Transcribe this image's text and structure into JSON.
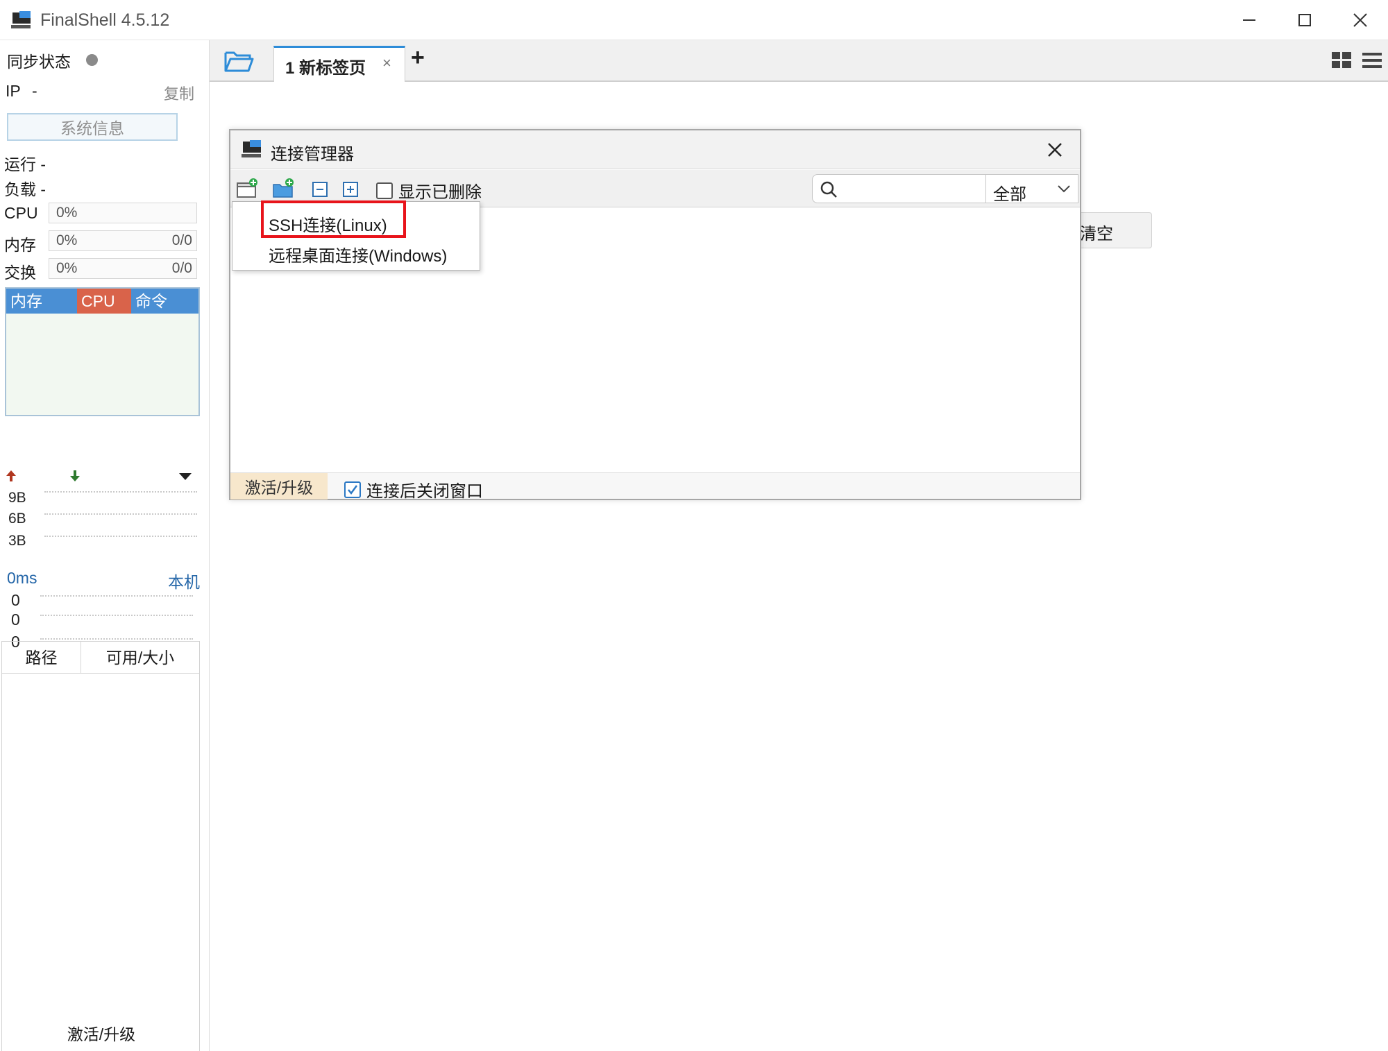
{
  "window": {
    "title": "FinalShell 4.5.12",
    "controls": [
      "minimize-icon",
      "maximize-icon",
      "close-icon"
    ]
  },
  "sidebar": {
    "sync_label": "同步状态",
    "ip_label": "IP",
    "ip_value": "-",
    "copy_label": "复制",
    "sysinfo_label": "系统信息",
    "run_label": "运行 -",
    "load_label": "负载 -",
    "meters": [
      {
        "label": "CPU",
        "percent": "0%",
        "ratio": ""
      },
      {
        "label": "内存",
        "percent": "0%",
        "ratio": "0/0"
      },
      {
        "label": "交换",
        "percent": "0%",
        "ratio": "0/0"
      }
    ],
    "process_tabs": [
      "内存",
      "CPU",
      "命令"
    ],
    "net_labels": [
      "9B",
      "6B",
      "3B"
    ],
    "ping_label": "0ms",
    "ping_host": "本机",
    "ping_values": [
      "0",
      "0",
      "0"
    ],
    "disk_columns": [
      "路径",
      "可用/大小"
    ],
    "activate_label": "激活/升级"
  },
  "tabs": {
    "items": [
      {
        "label": "1 新标签页",
        "close": "×"
      }
    ],
    "add": "+"
  },
  "background": {
    "clear_label": "清空"
  },
  "dialog": {
    "title": "连接管理器",
    "show_deleted_label": "显示已删除",
    "show_deleted_checked": false,
    "search_placeholder": "",
    "filter_value": "全部",
    "activate_label": "激活/升级",
    "close_after_label": "连接后关闭窗口",
    "close_after_checked": true
  },
  "new_menu": {
    "items": [
      "SSH连接(Linux)",
      "远程桌面连接(Windows)"
    ],
    "highlighted": "SSH连接(Linux)",
    "highlight_color": "#e8141b"
  },
  "colors": {
    "accent": "#2d8cd8",
    "cpu_tab": "#d9634a",
    "mem_tab": "#4a8fd4"
  }
}
